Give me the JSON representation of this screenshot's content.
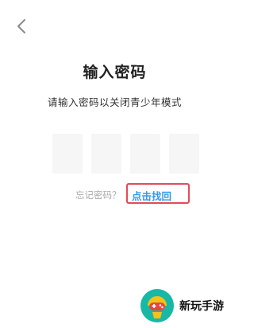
{
  "header": {
    "back_icon": "chevron-left-icon"
  },
  "main": {
    "title": "输入密码",
    "subtitle": "请输入密码以关闭青少年模式",
    "pin_length": 4,
    "forgot_label": "忘记密码？",
    "recover_link": "点击找回"
  },
  "colors": {
    "link": "#2f9ce8",
    "highlight_border": "#e24b5b",
    "pin_box_bg": "#f6f6f6"
  },
  "watermark": {
    "brand": "新玩手游",
    "logo_icon": "gamepad-logo-icon"
  }
}
